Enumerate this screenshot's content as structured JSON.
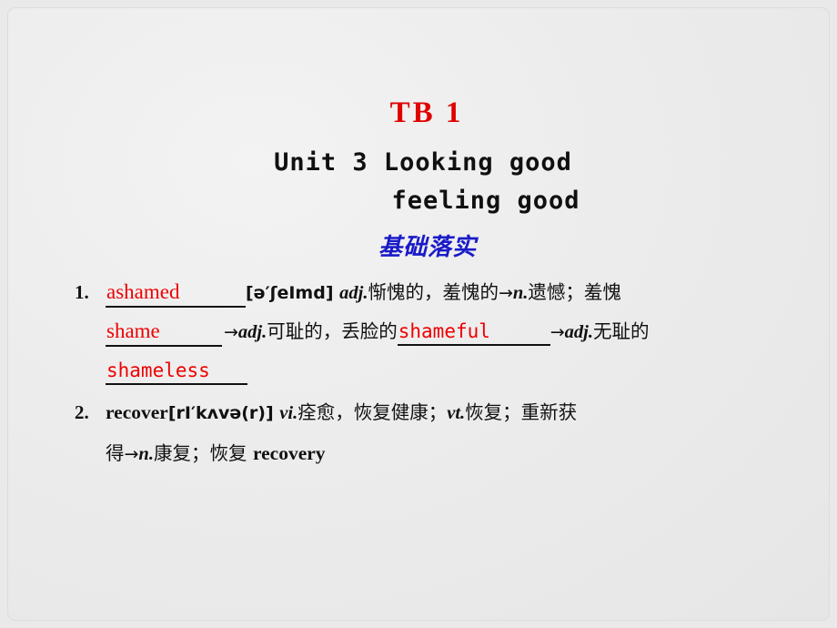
{
  "slide": {
    "title": "TB 1",
    "unit_line_1": "Unit 3  Looking good",
    "unit_line_2": "feeling good",
    "section_heading": "基础落实",
    "colors": {
      "title_red": "#e00000",
      "answer_red": "#ee0000",
      "heading_blue": "#1a1ac8",
      "body_black": "#111111",
      "background": "#ececec"
    }
  },
  "entries": [
    {
      "number": "1.",
      "lines": [
        {
          "parts": [
            {
              "type": "blank",
              "text": "ashamed"
            },
            {
              "type": "phonetic",
              "text": "[ə′ʃeImd]"
            },
            {
              "type": "pos",
              "text": "adj."
            },
            {
              "type": "cn",
              "text": "惭愧的，羞愧的"
            },
            {
              "type": "arrow",
              "text": "→"
            },
            {
              "type": "pos",
              "text": "n."
            },
            {
              "type": "cn",
              "text": "遗憾；羞愧"
            }
          ]
        },
        {
          "parts": [
            {
              "type": "blank",
              "text": "shame"
            },
            {
              "type": "arrow",
              "text": "→"
            },
            {
              "type": "pos",
              "text": "adj."
            },
            {
              "type": "cn",
              "text": "可耻的，丢脸的"
            },
            {
              "type": "blank",
              "text": "shameful"
            },
            {
              "type": "arrow",
              "text": "→"
            },
            {
              "type": "pos",
              "text": "adj."
            },
            {
              "type": "cn",
              "text": "无耻的"
            }
          ]
        },
        {
          "parts": [
            {
              "type": "blank",
              "text": "shameless"
            }
          ]
        }
      ]
    },
    {
      "number": "2.",
      "lines": [
        {
          "parts": [
            {
              "type": "en-bold",
              "text": "recover"
            },
            {
              "type": "phonetic",
              "text": "[rI′kʌvə(r)]"
            },
            {
              "type": "pos",
              "text": "vi."
            },
            {
              "type": "cn",
              "text": "痊愈，恢复健康；"
            },
            {
              "type": "pos",
              "text": "vt."
            },
            {
              "type": "cn",
              "text": "恢复；重新获"
            }
          ]
        },
        {
          "parts": [
            {
              "type": "cn",
              "text": "得"
            },
            {
              "type": "arrow",
              "text": "→"
            },
            {
              "type": "pos",
              "text": "n."
            },
            {
              "type": "cn",
              "text": "康复；恢复 "
            },
            {
              "type": "en-bold",
              "text": "recovery"
            }
          ]
        }
      ]
    }
  ]
}
